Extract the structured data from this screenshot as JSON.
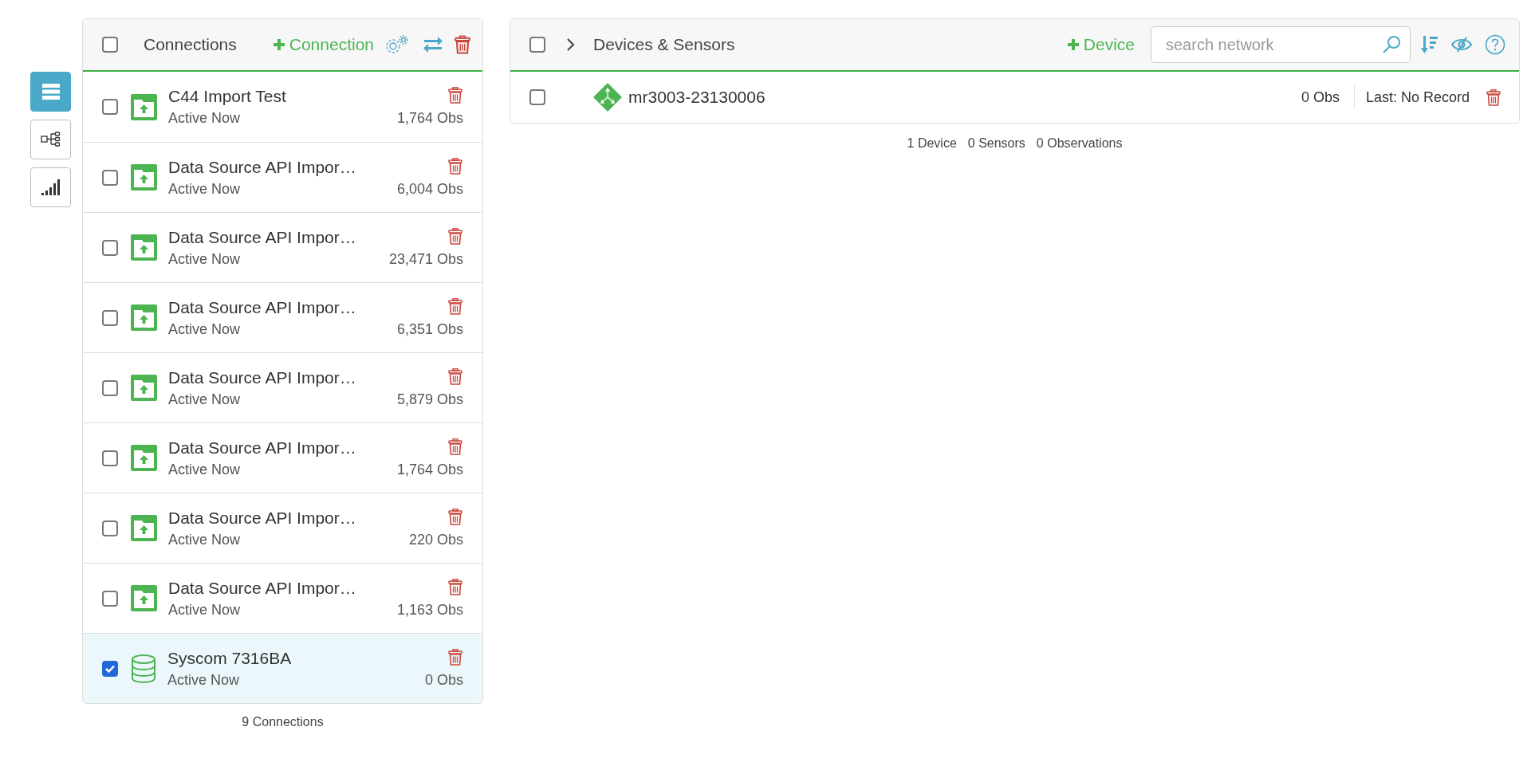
{
  "nav": [
    {
      "kind": "list",
      "selected": true
    },
    {
      "kind": "tree",
      "selected": false
    },
    {
      "kind": "signal",
      "selected": false
    }
  ],
  "connections": {
    "title": "Connections",
    "checked": false,
    "add_label": "Connection",
    "items": [
      {
        "kind": "import",
        "name": "C44 Import Test",
        "status": "Active Now",
        "obs": "1,764 Obs",
        "checked": false
      },
      {
        "kind": "import",
        "name": "Data Source API Impor…",
        "status": "Active Now",
        "obs": "6,004 Obs",
        "checked": false
      },
      {
        "kind": "import",
        "name": "Data Source API Impor…",
        "status": "Active Now",
        "obs": "23,471 Obs",
        "checked": false
      },
      {
        "kind": "import",
        "name": "Data Source API Impor…",
        "status": "Active Now",
        "obs": "6,351 Obs",
        "checked": false
      },
      {
        "kind": "import",
        "name": "Data Source API Impor…",
        "status": "Active Now",
        "obs": "5,879 Obs",
        "checked": false
      },
      {
        "kind": "import",
        "name": "Data Source API Impor…",
        "status": "Active Now",
        "obs": "1,764 Obs",
        "checked": false
      },
      {
        "kind": "import",
        "name": "Data Source API Impor…",
        "status": "Active Now",
        "obs": "220 Obs",
        "checked": false
      },
      {
        "kind": "import",
        "name": "Data Source API Impor…",
        "status": "Active Now",
        "obs": "1,163 Obs",
        "checked": false
      },
      {
        "kind": "database",
        "name": "Syscom 7316BA",
        "status": "Active Now",
        "obs": "0 Obs",
        "checked": true
      }
    ],
    "footer": "9 Connections"
  },
  "devices": {
    "title": "Devices & Sensors",
    "checked": false,
    "expanded": false,
    "add_label": "Device",
    "search": {
      "placeholder": "search network"
    },
    "items": [
      {
        "name": "mr3003-23130006",
        "obs": "0 Obs",
        "last": "Last: No Record",
        "checked": false
      }
    ],
    "footer": [
      "1 Device",
      "0 Sensors",
      "0 Observations"
    ]
  }
}
